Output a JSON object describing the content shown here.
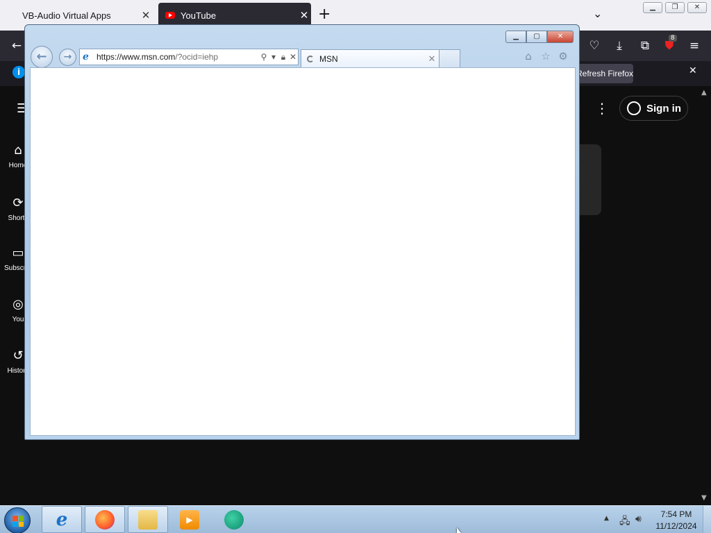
{
  "firefox": {
    "tabs": [
      {
        "label": "VB-Audio Virtual Apps"
      },
      {
        "label": "YouTube"
      }
    ],
    "notification": {
      "refresh_label": "Refresh Firefox..."
    },
    "badge_count": "8"
  },
  "youtube": {
    "sign_in_label": "Sign in",
    "sidebar": [
      {
        "label": "Home",
        "icon": "home-icon"
      },
      {
        "label": "Shorts",
        "icon": "shorts-icon"
      },
      {
        "label": "Subscriptions",
        "icon": "subscriptions-icon"
      },
      {
        "label": "You",
        "icon": "you-icon"
      },
      {
        "label": "History",
        "icon": "history-icon"
      }
    ]
  },
  "ie": {
    "address": {
      "main": "https://www.msn.com",
      "rest": "/?ocid=iehp"
    },
    "tab": {
      "label": "MSN"
    }
  },
  "taskbar": {
    "clock_time": "7:54 PM",
    "clock_date": "11/12/2024",
    "apps": [
      "internet-explorer",
      "firefox",
      "file-explorer",
      "media-player",
      "app"
    ]
  },
  "colors": {
    "ie_frame": "#a9c7e6",
    "youtube_red": "#ff0000",
    "firefox_dark": "#2b2a33"
  }
}
